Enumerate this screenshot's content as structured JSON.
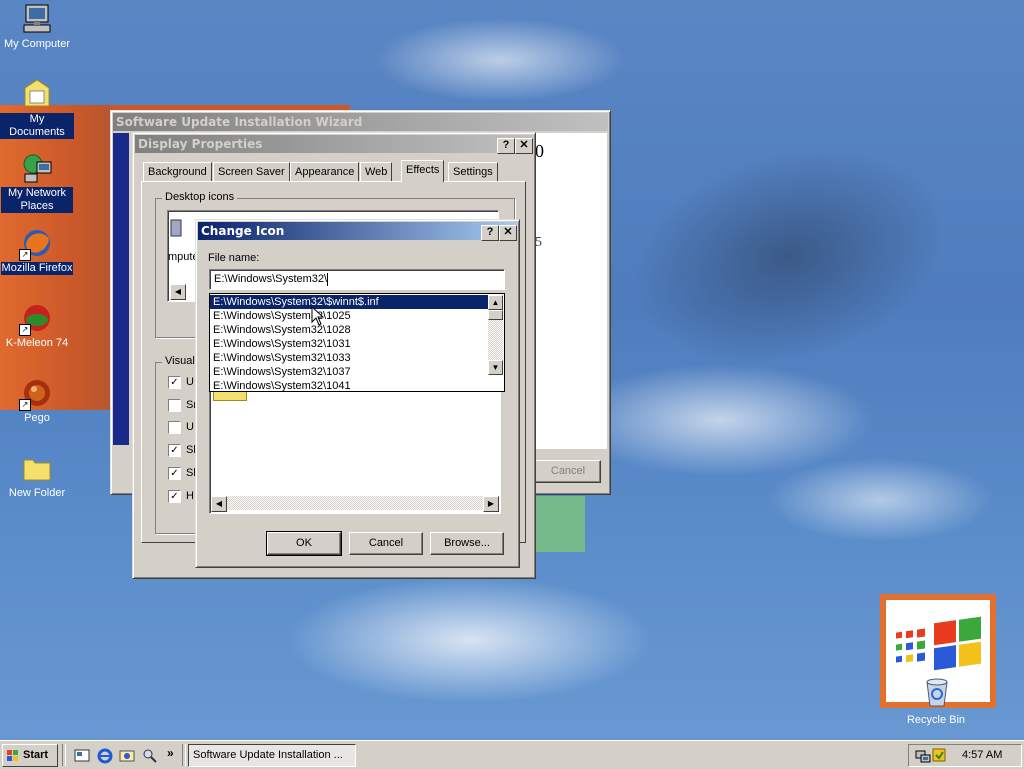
{
  "desktop": {
    "icons": [
      {
        "label": "My Computer",
        "icon": "computer-icon"
      },
      {
        "label": "My Documents",
        "icon": "folder-documents-icon"
      },
      {
        "label": "My Network Places",
        "icon": "network-icon"
      },
      {
        "label": "Mozilla Firefox",
        "icon": "firefox-icon"
      },
      {
        "label": "K-Meleon 74",
        "icon": "kmeleon-icon"
      },
      {
        "label": "Pego",
        "icon": "pego-icon"
      },
      {
        "label": "New Folder",
        "icon": "folder-icon"
      }
    ],
    "recycle_bin": "Recycle Bin"
  },
  "wizard": {
    "title": "Software Update Installation Wizard",
    "cancel_label": "Cancel",
    "partial_text_1": "0",
    "partial_text_2": "5"
  },
  "display_props": {
    "title": "Display Properties",
    "tabs": [
      "Background",
      "Screen Saver",
      "Appearance",
      "Web",
      "Effects",
      "Settings"
    ],
    "selected_tab": "Effects",
    "desktop_icons_group": "Desktop icons",
    "icon_partial_label": "mputer",
    "visual_group": "Visual",
    "visual_checks": [
      {
        "label": "U",
        "checked": true
      },
      {
        "label": "Sr",
        "checked": false
      },
      {
        "label": "U",
        "checked": false
      },
      {
        "label": "Sl",
        "checked": true
      },
      {
        "label": "Sl",
        "checked": true
      },
      {
        "label": "H",
        "checked": true
      }
    ]
  },
  "change_icon": {
    "title": "Change Icon",
    "file_name_label": "File name:",
    "file_name_value": "E:\\Windows\\System32\\",
    "dropdown_items": [
      "E:\\Windows\\System32\\$winnt$.inf",
      "E:\\Windows\\System32\\1025",
      "E:\\Windows\\System32\\1028",
      "E:\\Windows\\System32\\1031",
      "E:\\Windows\\System32\\1033",
      "E:\\Windows\\System32\\1037",
      "E:\\Windows\\System32\\1041"
    ],
    "ok_label": "OK",
    "cancel_label": "Cancel",
    "browse_label": "Browse..."
  },
  "taskbar": {
    "start_label": "Start",
    "chevron": "»",
    "task_button": "Software Update Installation ...",
    "clock": "4:57 AM"
  }
}
